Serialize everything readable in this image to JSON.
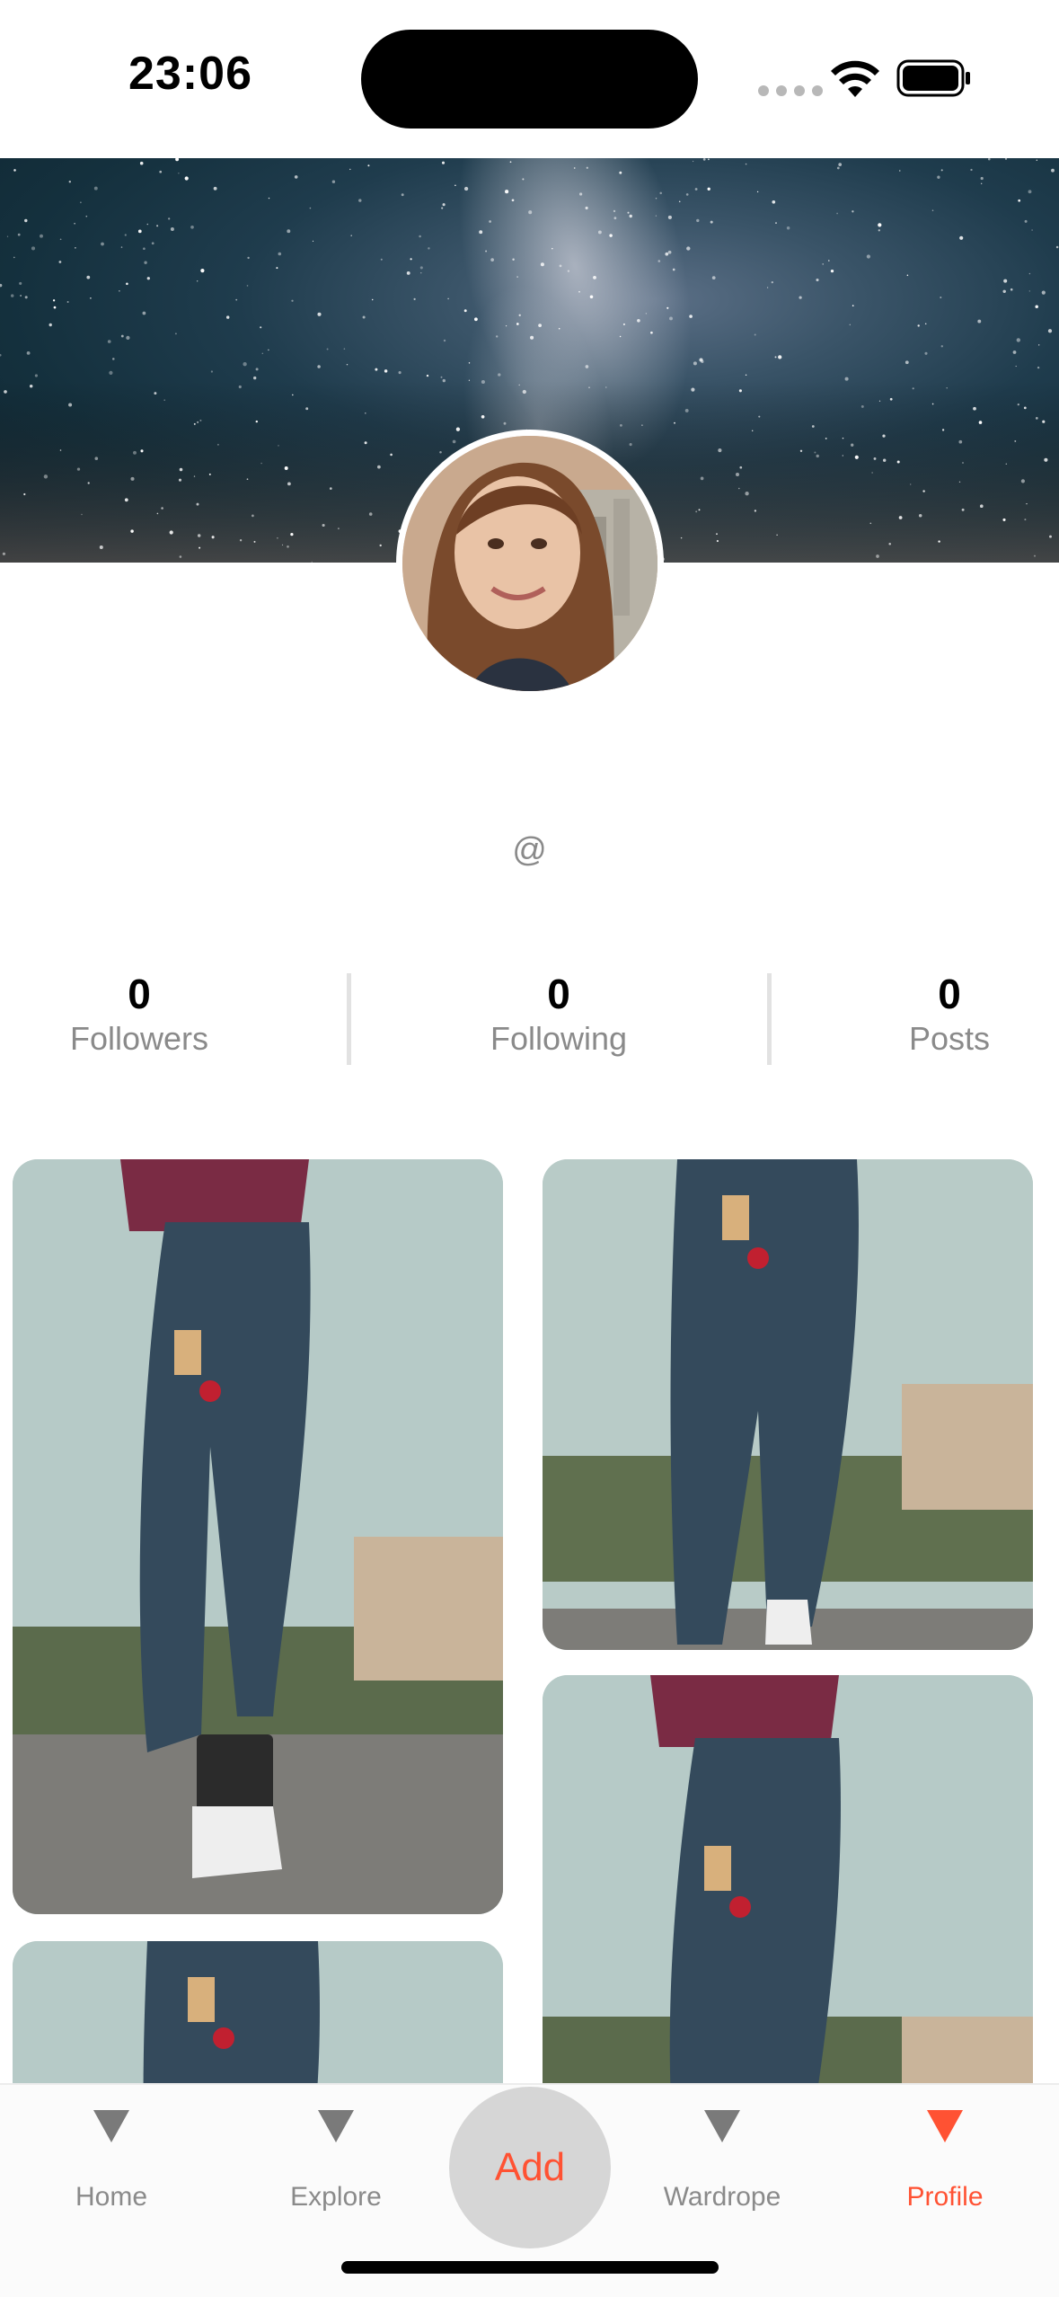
{
  "status_bar": {
    "time": "23:06"
  },
  "profile": {
    "handle": "@",
    "stats": [
      {
        "value": "0",
        "label": "Followers"
      },
      {
        "value": "0",
        "label": "Following"
      },
      {
        "value": "0",
        "label": "Posts"
      }
    ]
  },
  "posts": [
    {
      "alt": ""
    },
    {
      "alt": ""
    },
    {
      "alt": ""
    },
    {
      "alt": ""
    }
  ],
  "tab_bar": {
    "items": [
      {
        "label": "Home",
        "icon": "triangle-down-icon"
      },
      {
        "label": "Explore",
        "icon": "triangle-down-icon"
      },
      {
        "label": "Wardrope",
        "icon": "triangle-down-icon"
      },
      {
        "label": "Profile",
        "icon": "triangle-down-icon",
        "active": true
      }
    ],
    "add_label": "Add"
  },
  "colors": {
    "accent": "#ff5233",
    "inactive": "#7a7a7a",
    "add_bg": "#d6d6d6"
  }
}
